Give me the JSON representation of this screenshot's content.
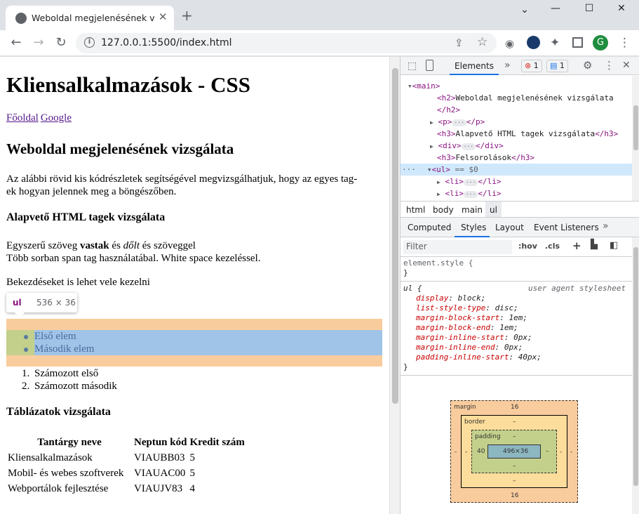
{
  "browser": {
    "tab_title": "Weboldal megjelenésének vizsgálata",
    "url": "127.0.0.1:5500/index.html",
    "avatar_letter": "G"
  },
  "page": {
    "h1": "Kliensalkalmazások - CSS",
    "nav": [
      "Főoldal",
      "Google"
    ],
    "h2": "Weboldal megjelenésének vizsgálata",
    "intro1": "Az alábbi rövid kis kódrészletek segítségével megvizsgálhatjuk, hogy az egyes tag-",
    "intro2": "ek hogyan jelennek meg a böngészőben.",
    "h3_basic": "Alapvető HTML tagek vizsgálata",
    "line1_a": "Egyszerű szöveg ",
    "line1_b": "vastak",
    "line1_c": " és ",
    "line1_d": "dőlt",
    "line1_e": " és szöveggel",
    "line2": "Több sorban span tag használatábal. White space kezeléssel.",
    "para": "Bekezdéseket is lehet vele kezelni",
    "ul": [
      "Első elem",
      "Második elem"
    ],
    "ol": [
      "Számozott első",
      "Számozott második"
    ],
    "h3_tables": "Táblázatok vizsgálata",
    "table": {
      "headers": [
        "Tantárgy neve",
        "Neptun kód",
        "Kredit szám"
      ],
      "rows": [
        [
          "Kliensalkalmazások",
          "VIAUBB03",
          "5"
        ],
        [
          "Mobil- és webes szoftverek",
          "VIAUAC00",
          "5"
        ],
        [
          "Webportálok fejlesztése",
          "VIAUJV83",
          "4"
        ]
      ]
    },
    "tooltip": {
      "tag": "ul",
      "dims": "536 × 36"
    }
  },
  "devtools": {
    "tabs": {
      "elements": "Elements",
      "errors": "1",
      "messages": "1"
    },
    "dom": {
      "main": "<main>",
      "h2": "Weboldal megjelenésének vizsgálata",
      "h3a": "Alapvető HTML tagek vizsgálata",
      "h3b": "Felsorolások",
      "ul_sel": "== $0"
    },
    "breadcrumbs": [
      "html",
      "body",
      "main",
      "ul"
    ],
    "subtabs": [
      "Computed",
      "Styles",
      "Layout",
      "Event Listeners"
    ],
    "filter_placeholder": "Filter",
    "hov": ":hov",
    "cls": ".cls",
    "element_style": "element.style {",
    "rule_selector": "ul {",
    "rule_source": "user agent stylesheet",
    "props": [
      [
        "display",
        "block"
      ],
      [
        "list-style-type",
        "disc"
      ],
      [
        "margin-block-start",
        "1em"
      ],
      [
        "margin-block-end",
        "1em"
      ],
      [
        "margin-inline-start",
        "0px"
      ],
      [
        "margin-inline-end",
        "0px"
      ],
      [
        "padding-inline-start",
        "40px"
      ]
    ],
    "boxmodel": {
      "margin_label": "margin",
      "border_label": "border",
      "padding_label": "padding",
      "margin_top": "16",
      "margin_bottom": "16",
      "margin_left": "-",
      "margin_right": "-",
      "border_top": "–",
      "border_bottom": "–",
      "border_left": "-",
      "border_right": "-",
      "padding_top": "–",
      "padding_bottom": "–",
      "padding_left": "40",
      "padding_right": "–",
      "content": "496×36"
    }
  }
}
